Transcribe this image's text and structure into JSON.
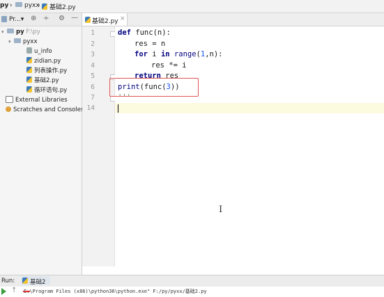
{
  "breadcrumb": {
    "root": "py",
    "folder": "pyxx",
    "file": "基础2.py",
    "separator": "›"
  },
  "project_panel": {
    "title": "Pr...",
    "dropdown": "▾",
    "icons": [
      "globe-icon",
      "collapse-icon",
      "gear-icon",
      "minimize-icon"
    ],
    "tree": {
      "root_name": "py",
      "root_path": "F:\\py",
      "folder": "pyxx",
      "files": [
        "u_info",
        "zidian.py",
        "列表操作.py",
        "基础2.py",
        "循环语句.py"
      ],
      "external_libraries": "External Libraries",
      "scratches": "Scratches and Consoles"
    }
  },
  "editor": {
    "tab_label": "基础2.py",
    "line_numbers": [
      "1",
      "2",
      "3",
      "4",
      "5",
      "6",
      "7",
      "14"
    ],
    "code": {
      "l1_kw": "def",
      "l1_rest": " func(n):",
      "l2": "res = n",
      "l3_kw1": "for",
      "l3_mid": " i ",
      "l3_kw2": "in",
      "l3_sp": " ",
      "l3_builtin": "range",
      "l3_open": "(",
      "l3_num": "1",
      "l3_close": ",n):",
      "l4": "res *= i",
      "l5_kw": "return",
      "l5_rest": " res",
      "l6_builtin": "print",
      "l6_mid": "(func(",
      "l6_num": "3",
      "l6_close": "))",
      "l7": "'''"
    }
  },
  "run_panel": {
    "label": "Run:",
    "tab": "基础2",
    "console_line": "E:\\Program Files (x86)\\python36\\python.exe\" F:/py/pyxx/基础2.py"
  },
  "colors": {
    "keyword": "#000080",
    "number": "#1750eb",
    "highlight_box": "#e05555",
    "caret_line": "#fcfadf"
  }
}
